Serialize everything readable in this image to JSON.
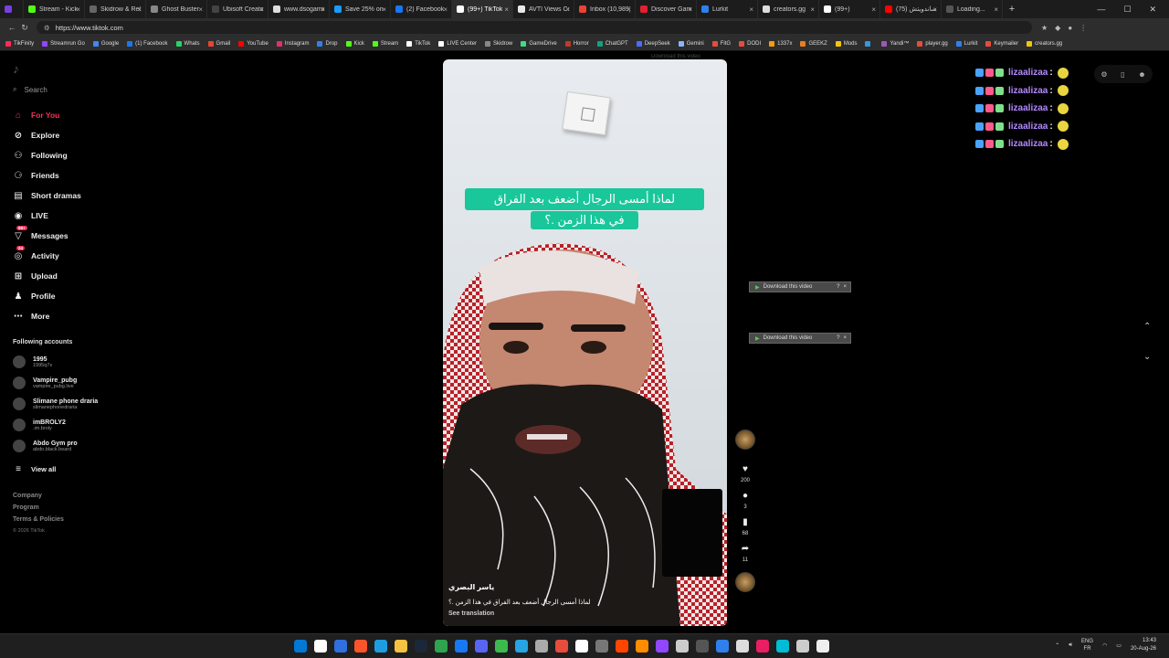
{
  "browser": {
    "tabs": [
      {
        "title": "",
        "color": "#7b3fe4"
      },
      {
        "title": "Stream - Kick",
        "color": "#53fc18"
      },
      {
        "title": "Skidrow & Rel",
        "color": "#666666"
      },
      {
        "title": "Ghost Buster",
        "color": "#888888"
      },
      {
        "title": "Ubisoft Creato",
        "color": "#444444"
      },
      {
        "title": "www.dsogamin",
        "color": "#dddddd"
      },
      {
        "title": "Save 25% on G",
        "color": "#1b9cfc"
      },
      {
        "title": "(2) Facebook",
        "color": "#1877f2"
      },
      {
        "title": "(99+) TikTok",
        "color": "#ffffff"
      },
      {
        "title": "AVTI Views Con",
        "color": "#e8e8e8"
      },
      {
        "title": "Inbox (10,989)",
        "color": "#ea4335"
      },
      {
        "title": "Discover Game",
        "color": "#e4202e"
      },
      {
        "title": "Lurkit",
        "color": "#2f80ed"
      },
      {
        "title": "creators.gg",
        "color": "#dddddd"
      },
      {
        "title": "(99+)",
        "color": "#ffffff"
      },
      {
        "title": "(75) ساندويتش",
        "color": "#ff0000"
      },
      {
        "title": "Loading...",
        "color": "#555555"
      }
    ],
    "url": "https://www.tiktok.com",
    "bookmarks": [
      {
        "label": "TikFinity",
        "color": "#fe2c55"
      },
      {
        "label": "Streamrun Go",
        "color": "#9146ff"
      },
      {
        "label": "Google",
        "color": "#4285f4"
      },
      {
        "label": "(1) Facebook",
        "color": "#1877f2"
      },
      {
        "label": "Whats",
        "color": "#25d366"
      },
      {
        "label": "Gmail",
        "color": "#ea4335"
      },
      {
        "label": "YouTube",
        "color": "#ff0000"
      },
      {
        "label": "Instagram",
        "color": "#e1306c"
      },
      {
        "label": "Drop",
        "color": "#2f80ed"
      },
      {
        "label": "Kick",
        "color": "#53fc18"
      },
      {
        "label": "Stream",
        "color": "#53fc18"
      },
      {
        "label": "TikTok",
        "color": "#ffffff"
      },
      {
        "label": "LIVE Center",
        "color": "#ffffff"
      },
      {
        "label": "Skidrow",
        "color": "#888888"
      },
      {
        "label": "GameDrive",
        "color": "#3ddc84"
      },
      {
        "label": "Horror",
        "color": "#c0392b"
      },
      {
        "label": "ChatGPT",
        "color": "#10a37f"
      },
      {
        "label": "DeepSeek",
        "color": "#4d6bfe"
      },
      {
        "label": "Gemini",
        "color": "#8ab4f8"
      },
      {
        "label": "FitG",
        "color": "#e74c3c"
      },
      {
        "label": "DODI",
        "color": "#e74c3c"
      },
      {
        "label": "1337x",
        "color": "#f39c12"
      },
      {
        "label": "GEEKZ",
        "color": "#e67e22"
      },
      {
        "label": "Mods",
        "color": "#f1c40f"
      },
      {
        "label": "",
        "color": "#3498db"
      },
      {
        "label": "Yandi™",
        "color": "#9b59b6"
      },
      {
        "label": "player.gg",
        "color": "#e74c3c"
      },
      {
        "label": "Lurkit",
        "color": "#2f80ed"
      },
      {
        "label": "Keymailer",
        "color": "#e74c3c"
      },
      {
        "label": "creators.gg",
        "color": "#f1c40f"
      }
    ]
  },
  "sidebar": {
    "search_placeholder": "Search",
    "nav": [
      {
        "label": "For You",
        "icon": "home-icon",
        "active": true
      },
      {
        "label": "Explore",
        "icon": "compass-icon"
      },
      {
        "label": "Following",
        "icon": "following-icon"
      },
      {
        "label": "Friends",
        "icon": "friends-icon"
      },
      {
        "label": "Short dramas",
        "icon": "short-dramas-icon"
      },
      {
        "label": "LIVE",
        "icon": "live-icon"
      },
      {
        "label": "Messages",
        "icon": "messages-icon",
        "badge": "99+"
      },
      {
        "label": "Activity",
        "icon": "activity-icon",
        "badge": "24"
      },
      {
        "label": "Upload",
        "icon": "upload-icon"
      },
      {
        "label": "Profile",
        "icon": "profile-icon"
      },
      {
        "label": "More",
        "icon": "more-icon"
      }
    ],
    "following_title": "Following accounts",
    "accounts": [
      {
        "name": "1995",
        "handle": "1995q7x"
      },
      {
        "name": "Vampire_pubg",
        "handle": "vampire_pubg.live"
      },
      {
        "name": "Slimane phone draria",
        "handle": "slimanephonedraria"
      },
      {
        "name": "imBROLY2",
        "handle": ".im.broly"
      },
      {
        "name": "Abdo Gym pro",
        "handle": "abdo.black.beard"
      }
    ],
    "view_all": "View all",
    "footer": [
      "Company",
      "Program",
      "Terms & Policies"
    ],
    "copyright": "© 2026 TikTok"
  },
  "video": {
    "caption_line1": "لماذا أمسى الرجال أضعف بعد الفراق",
    "caption_line2": "في هذا الزمن .؟",
    "author": "ياسر البصري",
    "description": "لماذا أمسى الرجال أضعف بعد الفراق في هذا الزمن .؟",
    "see_translation": "See translation",
    "likes": "200",
    "comments": "3",
    "saves": "68",
    "shares": "11"
  },
  "download": {
    "label": "Download this video",
    "help": "?",
    "close": "×"
  },
  "chat": {
    "user": "lizaalizaa",
    "lines": 5,
    "name_color": "#b388ff"
  },
  "taskbar": {
    "lang_top": "ENG",
    "lang_bottom": "FR",
    "time": "13:43",
    "date": "20-Aug-26"
  }
}
